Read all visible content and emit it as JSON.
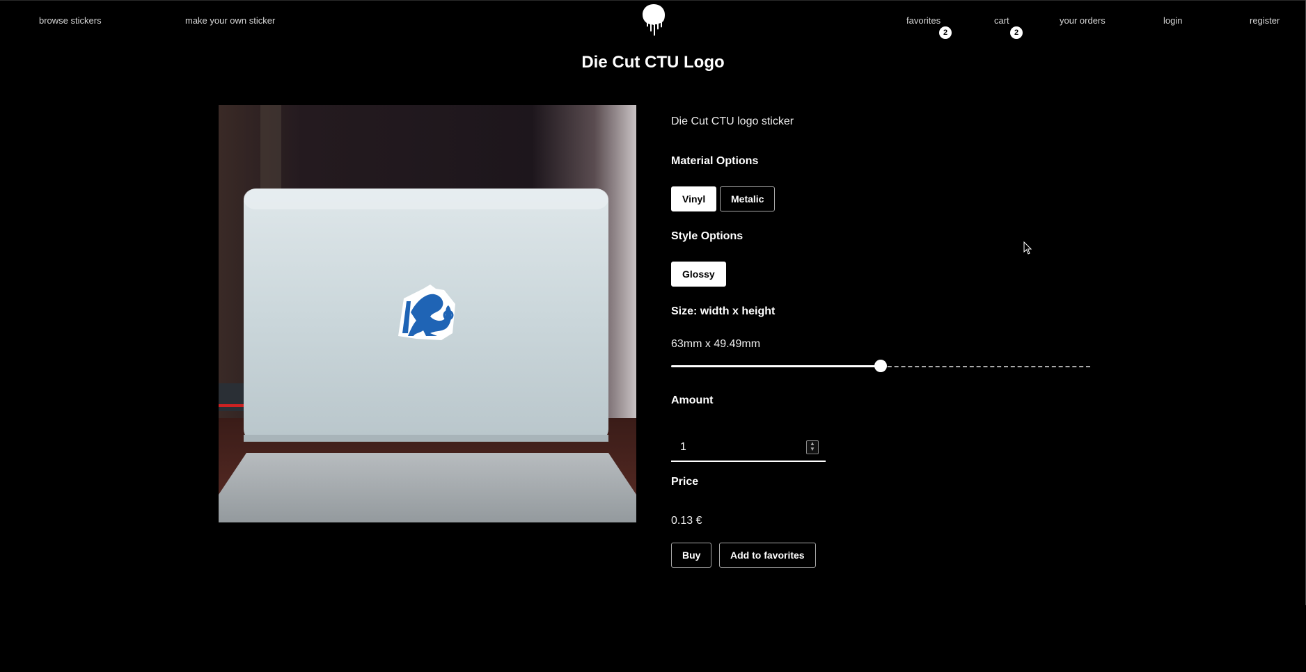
{
  "nav": {
    "browse": "browse stickers",
    "make": "make your own sticker",
    "favorites": "favorites",
    "favorites_count": "2",
    "cart": "cart",
    "cart_count": "2",
    "orders": "your orders",
    "login": "login",
    "register": "register",
    "logo_icon": "drip-logo-icon"
  },
  "product": {
    "title": "Die Cut CTU Logo",
    "description": "Die Cut CTU logo sticker",
    "image_icon": "laptop-with-ctu-sticker-image"
  },
  "material": {
    "label": "Material Options",
    "options": [
      "Vinyl",
      "Metalic"
    ],
    "selected": "Vinyl"
  },
  "style": {
    "label": "Style Options",
    "options": [
      "Glossy"
    ],
    "selected": "Glossy"
  },
  "size": {
    "label": "Size: width x height",
    "value": "63mm x 49.49mm",
    "slider_fraction": 0.5
  },
  "amount": {
    "label": "Amount",
    "value": "1"
  },
  "price": {
    "label": "Price",
    "value": "0.13 €"
  },
  "actions": {
    "buy": "Buy",
    "favorite": "Add to favorites"
  },
  "colors": {
    "background": "#000000",
    "text": "#ffffff",
    "sticker_blue": "#1f64b5"
  }
}
